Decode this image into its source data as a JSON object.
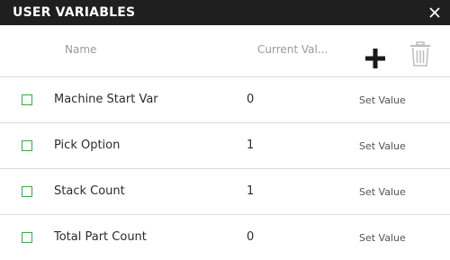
{
  "dialog": {
    "title": "USER VARIABLES",
    "close_icon": "close-icon"
  },
  "header": {
    "name_label": "Name",
    "current_value_label": "Current Val...",
    "add_icon": "plus-icon",
    "delete_icon": "trash-icon"
  },
  "rows": [
    {
      "name": "Machine Start Var",
      "value": "0",
      "action": "Set Value"
    },
    {
      "name": "Pick Option",
      "value": "1",
      "action": "Set Value"
    },
    {
      "name": "Stack Count",
      "value": "1",
      "action": "Set Value"
    },
    {
      "name": "Total Part Count",
      "value": "0",
      "action": "Set Value"
    }
  ],
  "colors": {
    "titlebar": "#1f1f1f",
    "checkbox": "#3aa845",
    "divider": "#dcdcdc"
  }
}
